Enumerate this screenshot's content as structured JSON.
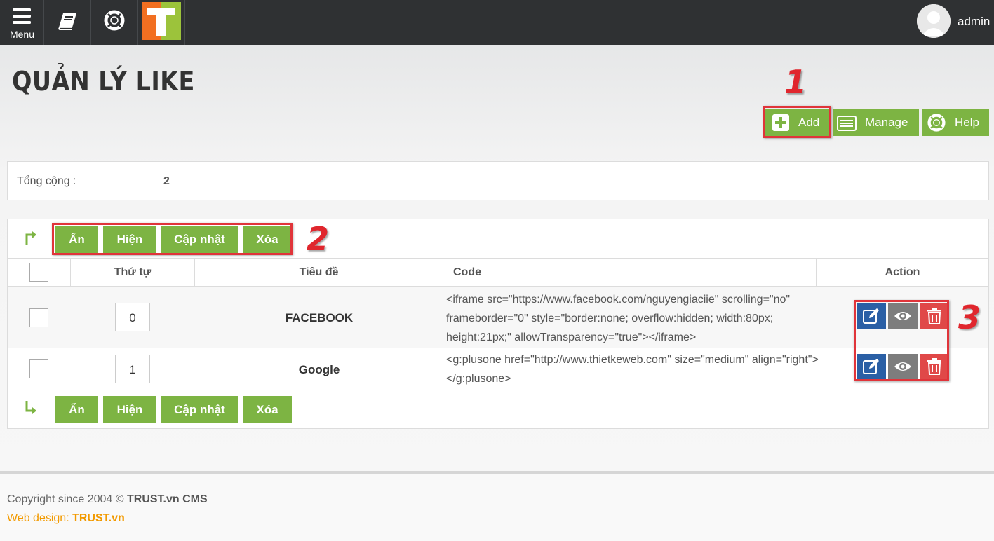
{
  "topbar": {
    "menu_label": "Menu",
    "logo_letter": "T",
    "user_name": "admin"
  },
  "page": {
    "title": "QUẢN LÝ LIKE"
  },
  "toolbar": {
    "add_label": "Add",
    "manage_label": "Manage",
    "help_label": "Help"
  },
  "annotations": {
    "n1": "1",
    "n2": "2",
    "n3": "3"
  },
  "summary": {
    "label": "Tổng cộng :",
    "value": "2"
  },
  "bulk_actions": {
    "hide": "Ẩn",
    "show": "Hiện",
    "update": "Cập nhật",
    "delete": "Xóa"
  },
  "table": {
    "columns": {
      "order": "Thứ tự",
      "title": "Tiêu đề",
      "code": "Code",
      "action": "Action"
    },
    "rows": [
      {
        "order": "0",
        "title": "FACEBOOK",
        "code": "<iframe src=\"https://www.facebook.com/nguyengiaciie\" scrolling=\"no\" frameborder=\"0\" style=\"border:none; overflow:hidden; width:80px; height:21px;\" allowTransparency=\"true\"></iframe>"
      },
      {
        "order": "1",
        "title": "Google",
        "code": "<g:plusone href=\"http://www.thietkeweb.com\" size=\"medium\" align=\"right\"></g:plusone>"
      }
    ]
  },
  "footer": {
    "copyright_prefix": "Copyright since 2004 © ",
    "copyright_brand": "TRUST.vn CMS",
    "webdesign_prefix": "Web design: ",
    "webdesign_brand": "TRUST.vn"
  },
  "colors": {
    "topbar": "#2f3133",
    "accent_green": "#7db443",
    "annotation_red": "#e0262d",
    "edit_blue": "#2a5fa5",
    "view_gray": "#7d7d7d",
    "delete_red": "#e04848",
    "footer_orange": "#f29a00"
  }
}
